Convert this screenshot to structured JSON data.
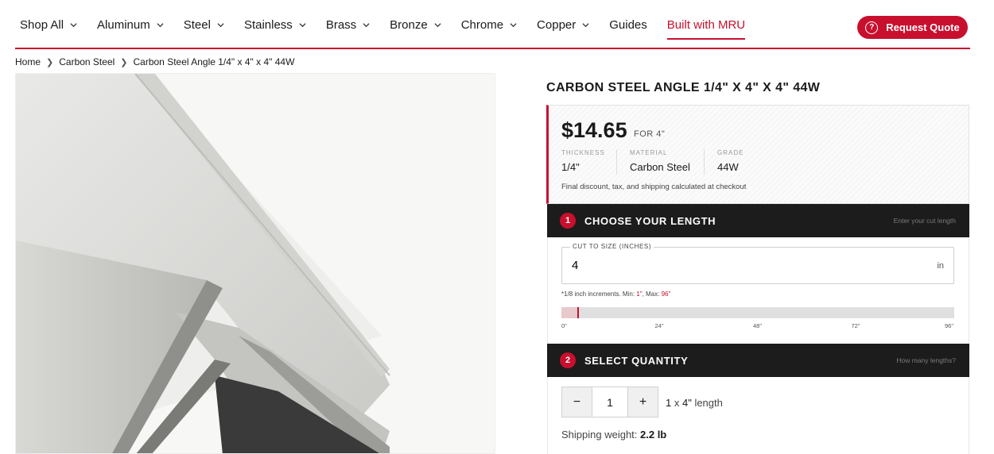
{
  "nav": {
    "items": [
      {
        "label": "Shop All",
        "dropdown": true
      },
      {
        "label": "Aluminum",
        "dropdown": true
      },
      {
        "label": "Steel",
        "dropdown": true
      },
      {
        "label": "Stainless",
        "dropdown": true
      },
      {
        "label": "Brass",
        "dropdown": true
      },
      {
        "label": "Bronze",
        "dropdown": true
      },
      {
        "label": "Chrome",
        "dropdown": true
      },
      {
        "label": "Copper",
        "dropdown": true
      },
      {
        "label": "Guides",
        "dropdown": false
      },
      {
        "label": "Built with MRU",
        "dropdown": false,
        "active": true
      }
    ],
    "quote_label": "Request Quote"
  },
  "breadcrumb": [
    "Home",
    "Carbon Steel",
    "Carbon Steel Angle 1/4\" x 4\" x 4\" 44W"
  ],
  "product": {
    "title": "CARBON STEEL ANGLE 1/4\" X 4\" X 4\" 44W",
    "price": "$14.65",
    "price_unit": "FOR 4\"",
    "specs": [
      {
        "label": "THICKNESS",
        "value": "1/4\""
      },
      {
        "label": "MATERIAL",
        "value": "Carbon Steel"
      },
      {
        "label": "GRADE",
        "value": "44W"
      }
    ],
    "fine_print": "Final discount, tax, and shipping calculated at checkout"
  },
  "step1": {
    "number": "1",
    "title": "CHOOSE YOUR LENGTH",
    "hint": "Enter your cut length",
    "field_label": "CUT TO SIZE (INCHES)",
    "field_value": "4",
    "field_unit": "in",
    "increments_prefix": "*1/8 inch increments. Min: ",
    "min": "1\"",
    "max_prefix": ", Max: ",
    "max": "96\"",
    "slider_value": 4,
    "slider_max": 96,
    "ticks": [
      "0\"",
      "24\"",
      "48\"",
      "72\"",
      "96\""
    ]
  },
  "step2": {
    "number": "2",
    "title": "SELECT QUANTITY",
    "hint": "How many lengths?",
    "minus": "−",
    "plus": "+",
    "quantity": "1",
    "desc_count": "1",
    "desc_mid": " x ",
    "desc_len": "4\"",
    "desc_suffix": " length",
    "shipping_label": "Shipping weight: ",
    "shipping_value": "2.2 lb"
  },
  "colors": {
    "accent": "#c8102e",
    "dark": "#1c1c1c"
  },
  "icons": {
    "dropdown": "chevron-down-icon",
    "quote": "question-circle-icon",
    "breadcrumb_sep": "chevron-right-icon"
  }
}
